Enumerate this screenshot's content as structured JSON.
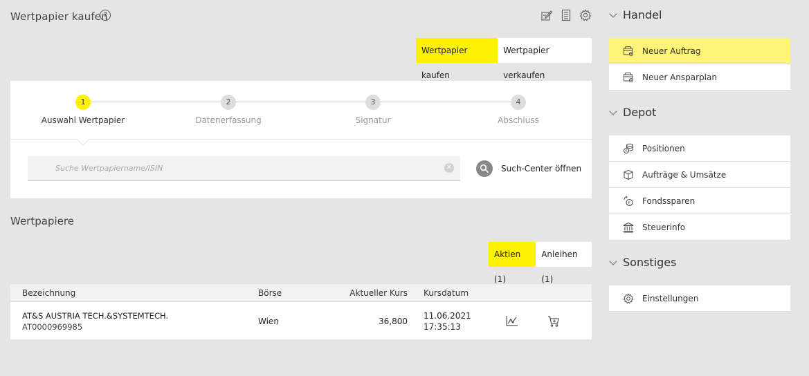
{
  "header": {
    "title": "Wertpapier kaufen",
    "help": "?"
  },
  "buy_sell": {
    "buy_label": "Wertpapier kaufen",
    "sell_label": "Wertpapier verkaufen"
  },
  "steps": [
    {
      "num": "1",
      "label": "Auswahl Wertpapier"
    },
    {
      "num": "2",
      "label": "Datenerfassung"
    },
    {
      "num": "3",
      "label": "Signatur"
    },
    {
      "num": "4",
      "label": "Abschluss"
    }
  ],
  "search": {
    "placeholder": "Suche Wertpapiername/ISIN",
    "clear": "✕",
    "center_label": "Such-Center öffnen"
  },
  "securities": {
    "title": "Wertpapiere",
    "tabs": [
      "Aktien (1)",
      "Anleihen (1)"
    ],
    "columns": [
      "Bezeichnung",
      "Börse",
      "Aktueller Kurs",
      "Kursdatum"
    ],
    "rows": [
      {
        "name": "AT&S AUSTRIA TECH.&SYSTEMTECH.",
        "isin": "AT0000969985",
        "exchange": "Wien",
        "price": "36,800",
        "date": "11.06.2021",
        "time": "17:35:13"
      }
    ]
  },
  "sidebar": {
    "handel": {
      "title": "Handel",
      "items": [
        "Neuer Auftrag",
        "Neuer Ansparplan"
      ]
    },
    "depot": {
      "title": "Depot",
      "items": [
        "Positionen",
        "Aufträge & Umsätze",
        "Fondssparen",
        "Steuerinfo"
      ]
    },
    "sonstiges": {
      "title": "Sonstiges",
      "items": [
        "Einstellungen"
      ]
    }
  },
  "colors": {
    "accent": "#fff200",
    "active_sidebar": "#fff37a",
    "background": "#e5e5e5"
  }
}
